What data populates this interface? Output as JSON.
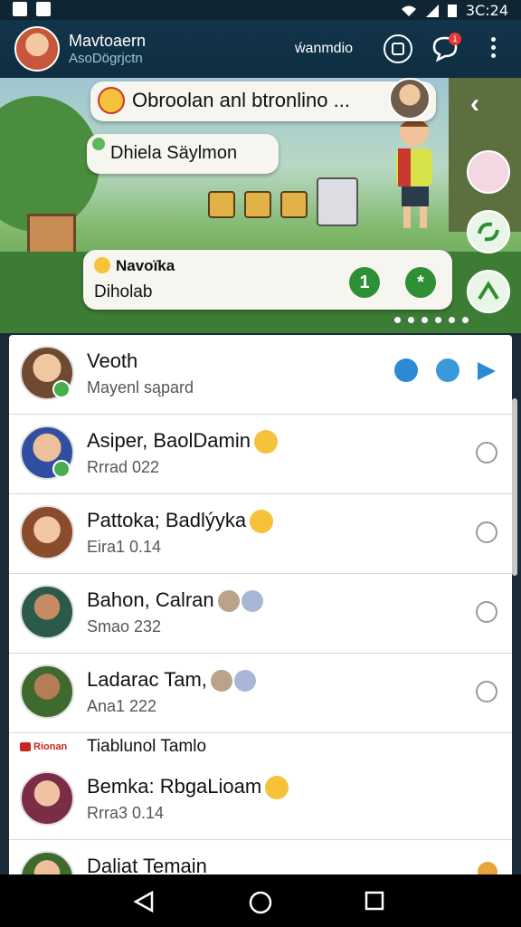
{
  "status": {
    "time": "3C:24"
  },
  "appbar": {
    "name": "Mavtoaern",
    "subtitle": "AsoDögrjctn",
    "action_label": "ẃanmdio",
    "notification_count": "1"
  },
  "hero": {
    "bubble1": "Obroolan anl btronlino ...",
    "bubble2": "Dhiela Säylmon",
    "card_title": "Navoïka",
    "card_text": "Diholab",
    "card_button1": "1",
    "card_button2": "*"
  },
  "chats": [
    {
      "name": "Veoth",
      "sub": "Mayenl sąpard",
      "type": "top"
    },
    {
      "name": "Asiper, BaolDamin",
      "sub": "Rrrad  022",
      "emoji": "smile"
    },
    {
      "name": "Pattoka; Badlýyka",
      "sub": "Eira1  0.14",
      "emoji": "smile"
    },
    {
      "name": "Bahon, Calran",
      "sub": "Smao  232",
      "emoji": "double"
    },
    {
      "name": "Ladarac Tam,",
      "sub": "Ana1  222",
      "emoji": "double"
    }
  ],
  "section": {
    "tag": "Rionan",
    "title": "Tiablunol Tamlo"
  },
  "chats2": [
    {
      "name": "Bemka: RbgaLioam",
      "sub": "Rrra3  0.14",
      "emoji": "smile"
    },
    {
      "name": "Daliat Temain",
      "sub": ""
    }
  ],
  "colors": {
    "appbar": "#123449",
    "accent": "#2a8ad6",
    "online": "#48ad4e"
  }
}
